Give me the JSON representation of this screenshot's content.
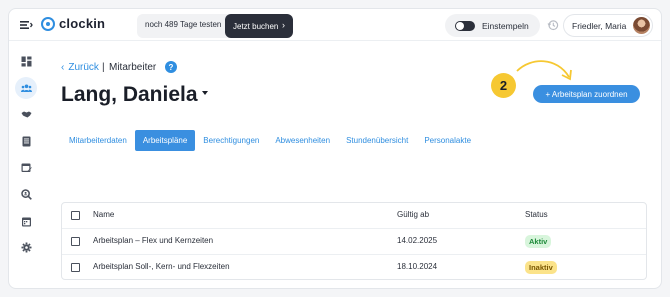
{
  "app": {
    "name": "clockin"
  },
  "header": {
    "trial_text": "noch 489 Tage testen",
    "buy_button": "Jetzt buchen",
    "clock_in_label": "Einstempeln",
    "user_name": "Friedler, Maria"
  },
  "breadcrumb": {
    "back_label": "Zurück",
    "separator": "|",
    "current": "Mitarbeiter"
  },
  "page": {
    "title": "Lang, Daniela",
    "step_number": "2",
    "assign_button": "+ Arbeitsplan zuordnen"
  },
  "tabs": [
    {
      "label": "Mitarbeiterdaten",
      "active": false
    },
    {
      "label": "Arbeitspläne",
      "active": true
    },
    {
      "label": "Berechtigungen",
      "active": false
    },
    {
      "label": "Abwesenheiten",
      "active": false
    },
    {
      "label": "Stundenübersicht",
      "active": false
    },
    {
      "label": "Personalakte",
      "active": false
    }
  ],
  "table": {
    "columns": {
      "name": "Name",
      "valid_from": "Gültig ab",
      "status": "Status"
    },
    "rows": [
      {
        "name": "Arbeitsplan – Flex und Kernzeiten",
        "valid_from": "14.02.2025",
        "status": "Aktiv",
        "status_color": "#1e8a3a"
      },
      {
        "name": "Arbeitsplan Soll-, Kern- und Flexzeiten",
        "valid_from": "18.10.2024",
        "status": "Inaktiv",
        "status_color": "#7a5600"
      }
    ]
  },
  "sidebar": {
    "items": [
      {
        "icon": "dashboard-icon"
      },
      {
        "icon": "team-icon",
        "active": true
      },
      {
        "icon": "handshake-icon"
      },
      {
        "icon": "document-icon"
      },
      {
        "icon": "calendar-edit-icon"
      },
      {
        "icon": "search-user-icon"
      },
      {
        "icon": "calendar-icon"
      },
      {
        "icon": "gear-icon"
      }
    ]
  },
  "colors": {
    "accent": "#3a8fe0",
    "step_badge": "#f6c832",
    "dark_button": "#2b2f3a"
  }
}
